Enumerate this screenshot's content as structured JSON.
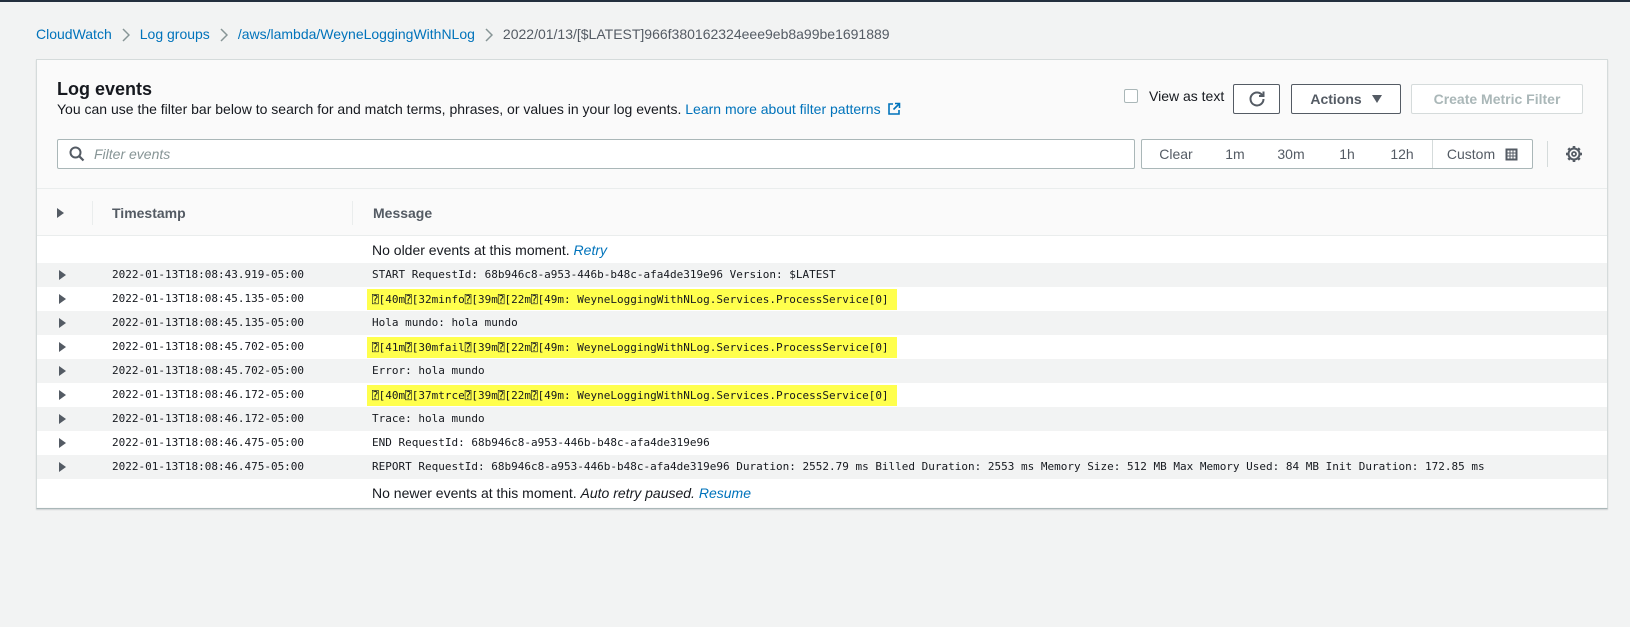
{
  "breadcrumb": {
    "items": [
      {
        "label": "CloudWatch",
        "link": true
      },
      {
        "label": "Log groups",
        "link": true
      },
      {
        "label": "/aws/lambda/WeyneLoggingWithNLog",
        "link": true
      },
      {
        "label": "2022/01/13/[$LATEST]966f380162324eee9eb8a99be1691889",
        "link": false
      }
    ]
  },
  "panel": {
    "title": "Log events",
    "description": "You can use the filter bar below to search for and match terms, phrases, or values in your log events.",
    "learn_more_link": "Learn more about filter patterns",
    "view_as_text_label": "View as text",
    "view_as_text_checked": false,
    "actions_label": "Actions",
    "create_metric_filter_label": "Create Metric Filter",
    "filter_placeholder": "Filter events",
    "filter_value": "",
    "time_range": {
      "clear": "Clear",
      "options": [
        "1m",
        "30m",
        "1h",
        "12h"
      ],
      "custom": "Custom"
    }
  },
  "table": {
    "columns": [
      "Timestamp",
      "Message"
    ],
    "no_older": {
      "text": "No older events at this moment.",
      "retry": "Retry"
    },
    "rows": [
      {
        "timestamp": "2022-01-13T18:08:43.919-05:00",
        "message": "START RequestId: 68b946c8-a953-446b-b48c-afa4de319e96 Version: $LATEST",
        "highlighted": false
      },
      {
        "timestamp": "2022-01-13T18:08:45.135-05:00",
        "message": "⍰[40m⍰[32minfo⍰[39m⍰[22m⍰[49m: WeyneLoggingWithNLog.Services.ProcessService[0]",
        "highlighted": true
      },
      {
        "timestamp": "2022-01-13T18:08:45.135-05:00",
        "message": "Hola mundo: hola mundo",
        "highlighted": false
      },
      {
        "timestamp": "2022-01-13T18:08:45.702-05:00",
        "message": "⍰[41m⍰[30mfail⍰[39m⍰[22m⍰[49m: WeyneLoggingWithNLog.Services.ProcessService[0]",
        "highlighted": true
      },
      {
        "timestamp": "2022-01-13T18:08:45.702-05:00",
        "message": "Error: hola mundo",
        "highlighted": false
      },
      {
        "timestamp": "2022-01-13T18:08:46.172-05:00",
        "message": "⍰[40m⍰[37mtrce⍰[39m⍰[22m⍰[49m: WeyneLoggingWithNLog.Services.ProcessService[0]",
        "highlighted": true
      },
      {
        "timestamp": "2022-01-13T18:08:46.172-05:00",
        "message": "Trace: hola mundo",
        "highlighted": false
      },
      {
        "timestamp": "2022-01-13T18:08:46.475-05:00",
        "message": "END RequestId: 68b946c8-a953-446b-b48c-afa4de319e96",
        "highlighted": false
      },
      {
        "timestamp": "2022-01-13T18:08:46.475-05:00",
        "message": "REPORT RequestId: 68b946c8-a953-446b-b48c-afa4de319e96 Duration: 2552.79 ms Billed Duration: 2553 ms Memory Size: 512 MB Max Memory Used: 84 MB Init Duration: 172.85 ms",
        "highlighted": false
      }
    ],
    "no_newer": {
      "text": "No newer events at this moment.",
      "paused": "Auto retry paused.",
      "resume": "Resume"
    }
  },
  "colors": {
    "link": "#0073bb",
    "highlight": "#ffff4d",
    "row_alt": "#f2f3f3"
  }
}
